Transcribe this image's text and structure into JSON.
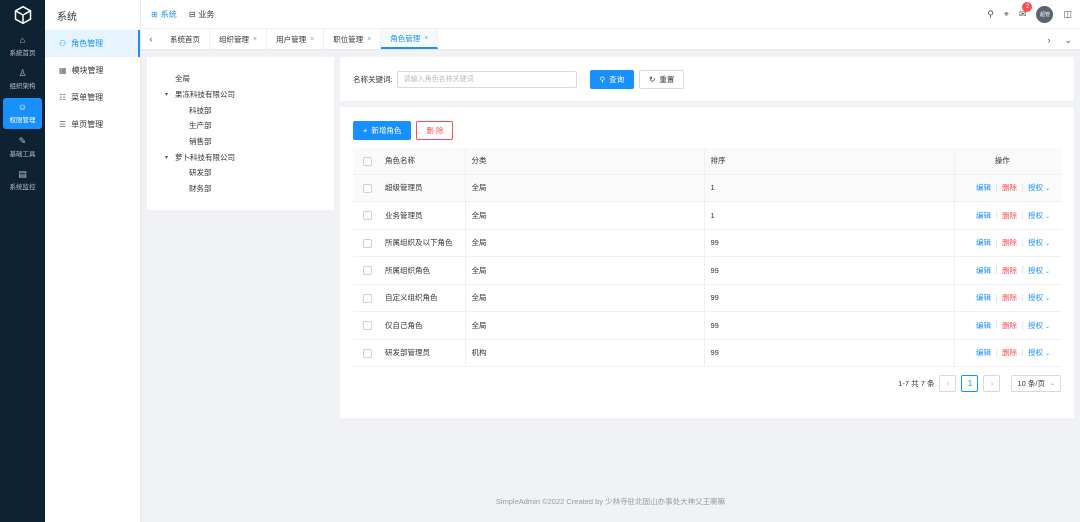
{
  "rail": {
    "items": [
      {
        "label": "系統首页",
        "icon": "home-icon",
        "glyph": "⌂"
      },
      {
        "label": "组织架构",
        "icon": "org-chart-icon",
        "glyph": "♙"
      },
      {
        "label": "权限管理",
        "icon": "user-permission-icon",
        "glyph": "☺"
      },
      {
        "label": "基础工具",
        "icon": "wrench-icon",
        "glyph": "✎"
      },
      {
        "label": "系统监控",
        "icon": "monitor-icon",
        "glyph": "▤"
      }
    ]
  },
  "submenu": {
    "title": "系统",
    "items": [
      {
        "label": "角色管理",
        "icon": "role-icon",
        "glyph": "⚇"
      },
      {
        "label": "模块管理",
        "icon": "module-icon",
        "glyph": "▦"
      },
      {
        "label": "菜单管理",
        "icon": "menu-icon",
        "glyph": "☷"
      },
      {
        "label": "单页管理",
        "icon": "page-icon",
        "glyph": "☰"
      }
    ]
  },
  "topnav": {
    "items": [
      {
        "label": "系统",
        "glyph": "⊞",
        "active": true
      },
      {
        "label": "业务",
        "glyph": "⊟",
        "active": false
      }
    ],
    "notification_count": "2",
    "avatar_text": "超管"
  },
  "tabs": [
    {
      "label": "系统首页",
      "closable": false
    },
    {
      "label": "组织管理",
      "closable": true
    },
    {
      "label": "用户管理",
      "closable": true
    },
    {
      "label": "职位管理",
      "closable": true
    },
    {
      "label": "角色管理",
      "closable": true
    }
  ],
  "tree": {
    "nodes": [
      {
        "label": "全局",
        "level": 0,
        "toggle": ""
      },
      {
        "label": "果冻科技有限公司",
        "level": 0,
        "toggle": "▾"
      },
      {
        "label": "科技部",
        "level": 1,
        "toggle": ""
      },
      {
        "label": "生产部",
        "level": 1,
        "toggle": ""
      },
      {
        "label": "销售部",
        "level": 1,
        "toggle": ""
      },
      {
        "label": "萝卜科技有限公司",
        "level": 0,
        "toggle": "▾"
      },
      {
        "label": "研发部",
        "level": 1,
        "toggle": ""
      },
      {
        "label": "财务部",
        "level": 1,
        "toggle": ""
      }
    ]
  },
  "search": {
    "label": "名称关键词:",
    "placeholder": "请输入角色名称关键词",
    "value": "",
    "query_label": "查询",
    "reset_label": "重置"
  },
  "toolbar": {
    "add_label": "新增角色",
    "delete_label": "删 除"
  },
  "table": {
    "headers": {
      "name": "角色名称",
      "category": "分类",
      "sort": "排序",
      "actions": "操作"
    },
    "rows": [
      {
        "name": "超级管理员",
        "category": "全局",
        "sort": "1"
      },
      {
        "name": "业务管理员",
        "category": "全局",
        "sort": "1"
      },
      {
        "name": "所属组织及以下角色",
        "category": "全局",
        "sort": "99"
      },
      {
        "name": "所属组织角色",
        "category": "全局",
        "sort": "99"
      },
      {
        "name": "自定义组织角色",
        "category": "全局",
        "sort": "99"
      },
      {
        "name": "仅自己角色",
        "category": "全局",
        "sort": "99"
      },
      {
        "name": "研发部管理员",
        "category": "机构",
        "sort": "99"
      }
    ],
    "action_labels": {
      "edit": "编辑",
      "delete": "删除",
      "grant": "授权"
    }
  },
  "pagination": {
    "summary": "1-7 共 7 条",
    "current_page": "1",
    "page_size": "10 条/页"
  },
  "footer": {
    "text": "SimpleAdmin ©2022 Created by 少林寺驻北固山办事处大神父王喇嘛"
  },
  "colors": {
    "primary": "#1890ff",
    "danger": "#ff4d4f",
    "rail_bg": "#0f2234"
  }
}
